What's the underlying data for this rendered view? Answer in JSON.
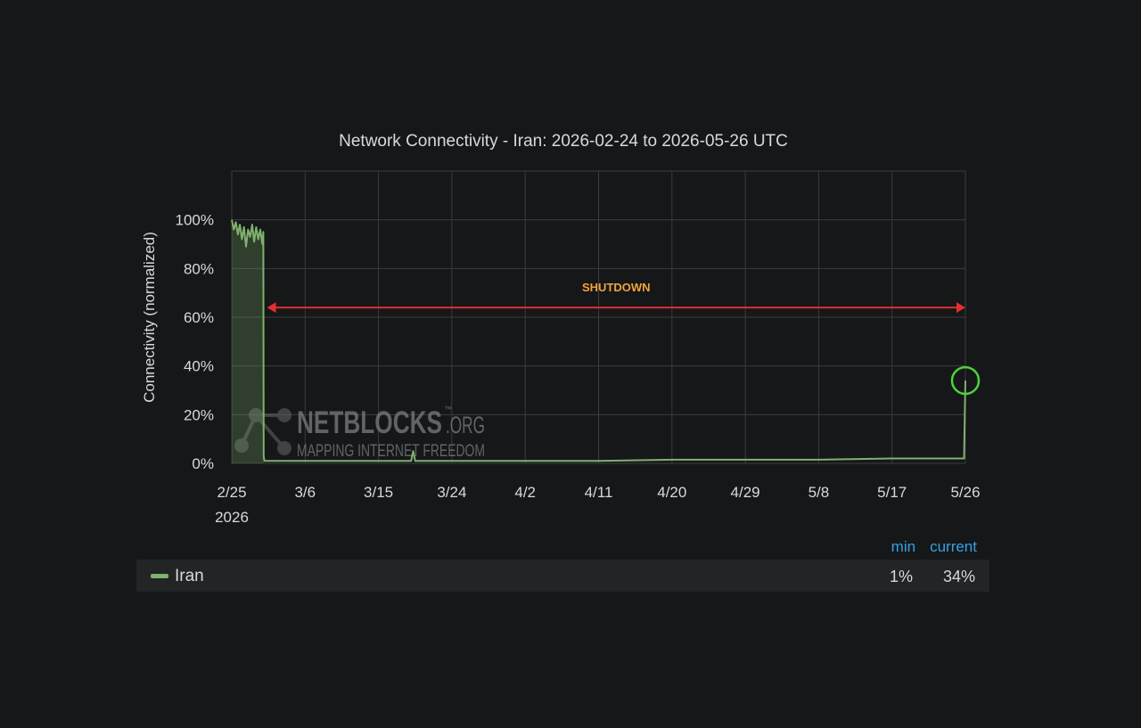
{
  "chart_data": {
    "type": "line",
    "title": "Network Connectivity - Iran: 2026-02-24 to 2026-05-26 UTC",
    "ylabel": "Connectivity (normalized)",
    "xlabel": "",
    "yticks": [
      "0%",
      "20%",
      "40%",
      "60%",
      "80%",
      "100%"
    ],
    "ylim": [
      0,
      120
    ],
    "xticks": [
      "2/25",
      "3/6",
      "3/15",
      "3/24",
      "4/2",
      "4/11",
      "4/20",
      "4/29",
      "5/8",
      "5/17",
      "5/26"
    ],
    "xticks_year_label": "2026",
    "xlim": [
      "2026-02-25",
      "2026-05-26"
    ],
    "grid": true,
    "series": [
      {
        "name": "Iran",
        "color": "#7eb26d",
        "points": [
          [
            "2026-02-25",
            100
          ],
          [
            "2026-02-25T06",
            96
          ],
          [
            "2026-02-25T12",
            99
          ],
          [
            "2026-02-25T18",
            94
          ],
          [
            "2026-02-26",
            98
          ],
          [
            "2026-02-26T06",
            92
          ],
          [
            "2026-02-26T12",
            97
          ],
          [
            "2026-02-26T18",
            89
          ],
          [
            "2026-02-27",
            96
          ],
          [
            "2026-02-27T06",
            93
          ],
          [
            "2026-02-27T12",
            98
          ],
          [
            "2026-02-27T18",
            91
          ],
          [
            "2026-02-28",
            97
          ],
          [
            "2026-02-28T06",
            92
          ],
          [
            "2026-02-28T12",
            96
          ],
          [
            "2026-02-28T18",
            90
          ],
          [
            "2026-02-28T21",
            95
          ],
          [
            "2026-02-28T22",
            3
          ],
          [
            "2026-03-01",
            1
          ],
          [
            "2026-03-06",
            1
          ],
          [
            "2026-03-15",
            1
          ],
          [
            "2026-03-19",
            1
          ],
          [
            "2026-03-19T06",
            5
          ],
          [
            "2026-03-19T12",
            1
          ],
          [
            "2026-03-24",
            1
          ],
          [
            "2026-04-02",
            1
          ],
          [
            "2026-04-11",
            1
          ],
          [
            "2026-04-20",
            1.5
          ],
          [
            "2026-04-29",
            1.5
          ],
          [
            "2026-05-08",
            1.5
          ],
          [
            "2026-05-17",
            2
          ],
          [
            "2026-05-25",
            2
          ],
          [
            "2026-05-25T20",
            2
          ],
          [
            "2026-05-26",
            34
          ]
        ]
      }
    ],
    "annotations": {
      "shutdown_label": "SHUTDOWN",
      "shutdown_level": 64,
      "shutdown_start": "2026-03-01",
      "shutdown_end": "2026-05-26",
      "shutdown_color": "#e02f2f",
      "shutdown_label_color": "#f0a33a",
      "highlight_circle_date": "2026-05-26",
      "highlight_circle_value": 34,
      "highlight_circle_color": "#4bd33a",
      "shaded_region_start": "2026-02-25",
      "shaded_region_end": "2026-02-28T22"
    }
  },
  "watermark": {
    "brand": "NETBLOCKS",
    "suffix": ".ORG",
    "trademark": "™",
    "tagline": "MAPPING INTERNET FREEDOM"
  },
  "legend": {
    "header_min": "min",
    "header_current": "current",
    "series_name": "Iran",
    "min_value": "1%",
    "current_value": "34%"
  }
}
